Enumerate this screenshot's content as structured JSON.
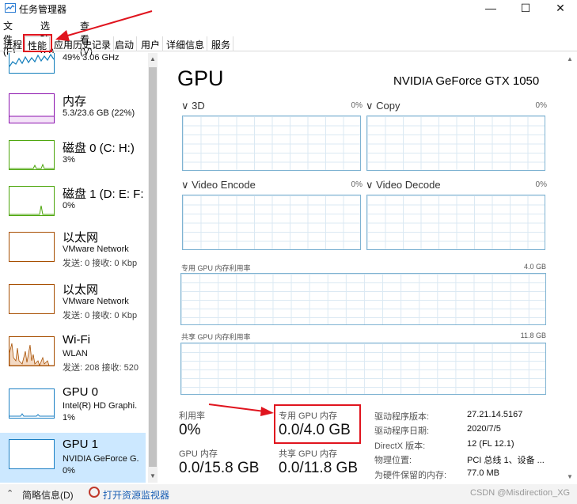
{
  "window": {
    "title": "任务管理器",
    "controls": {
      "minimize": "—",
      "maximize": "☐",
      "close": "✕"
    }
  },
  "menu": {
    "file": "文件(F)",
    "options": "选项(O)",
    "view": "查看(V)"
  },
  "tabs": [
    {
      "label": "进程"
    },
    {
      "label": "性能"
    },
    {
      "label": "应用历史记录"
    },
    {
      "label": "启动"
    },
    {
      "label": "用户"
    },
    {
      "label": "详细信息"
    },
    {
      "label": "服务"
    }
  ],
  "sidebar": {
    "cpu": {
      "subtitle": "49% 3.06 GHz"
    },
    "memory": {
      "title": "内存",
      "subtitle": "5.3/23.6 GB (22%)"
    },
    "disk0": {
      "title": "磁盘 0 (C: H:)",
      "subtitle": "3%"
    },
    "disk1": {
      "title": "磁盘 1 (D: E: F:",
      "subtitle": "0%"
    },
    "eth1": {
      "title": "以太网",
      "line1": "VMware Network",
      "line2": "发送: 0 接收: 0 Kbp"
    },
    "eth2": {
      "title": "以太网",
      "line1": "VMware Network",
      "line2": "发送: 0 接收: 0 Kbp"
    },
    "wifi": {
      "title": "Wi-Fi",
      "line1": "WLAN",
      "line2": "发送: 208 接收: 520"
    },
    "gpu0": {
      "title": "GPU 0",
      "line1": "Intel(R) HD Graphi.",
      "line2": "1%"
    },
    "gpu1": {
      "title": "GPU 1",
      "line1": "NVIDIA GeForce G.",
      "line2": "0%"
    }
  },
  "colors": {
    "cpu": "#117dbb",
    "memory": "#8b12ae",
    "disk": "#4da60c",
    "network": "#a74f01",
    "gpu": "#1c80c4",
    "selected": "#cce8ff",
    "highlight": "#e0141e"
  },
  "main": {
    "title": "GPU",
    "model": "NVIDIA GeForce GTX 1050",
    "engines": [
      {
        "name": "3D",
        "pct": "0%"
      },
      {
        "name": "Copy",
        "pct": "0%"
      },
      {
        "name": "Video Encode",
        "pct": "0%"
      },
      {
        "name": "Video Decode",
        "pct": "0%"
      }
    ],
    "dedicated_label": "专用 GPU 内存利用率",
    "dedicated_max": "4.0 GB",
    "shared_label": "共享 GPU 内存利用率",
    "shared_max": "11.8 GB"
  },
  "stats": {
    "utilization_label": "利用率",
    "utilization_value": "0%",
    "dedicated_label": "专用 GPU 内存",
    "dedicated_value": "0.0/4.0 GB",
    "gpu_mem_label": "GPU 内存",
    "gpu_mem_value": "0.0/15.8 GB",
    "shared_label": "共享 GPU 内存",
    "shared_value": "0.0/11.8 GB"
  },
  "info": [
    {
      "label": "驱动程序版本:",
      "value": "27.21.14.5167"
    },
    {
      "label": "驱动程序日期:",
      "value": "2020/7/5"
    },
    {
      "label": "DirectX 版本:",
      "value": "12 (FL 12.1)"
    },
    {
      "label": "物理位置:",
      "value": "PCI 总线 1、设备 ..."
    },
    {
      "label": "为硬件保留的内存:",
      "value": "77.0 MB"
    }
  ],
  "footer": {
    "less_details": "简略信息(D)",
    "open_monitor": "打开资源监视器",
    "watermark": "CSDN @Misdirection_XG"
  }
}
